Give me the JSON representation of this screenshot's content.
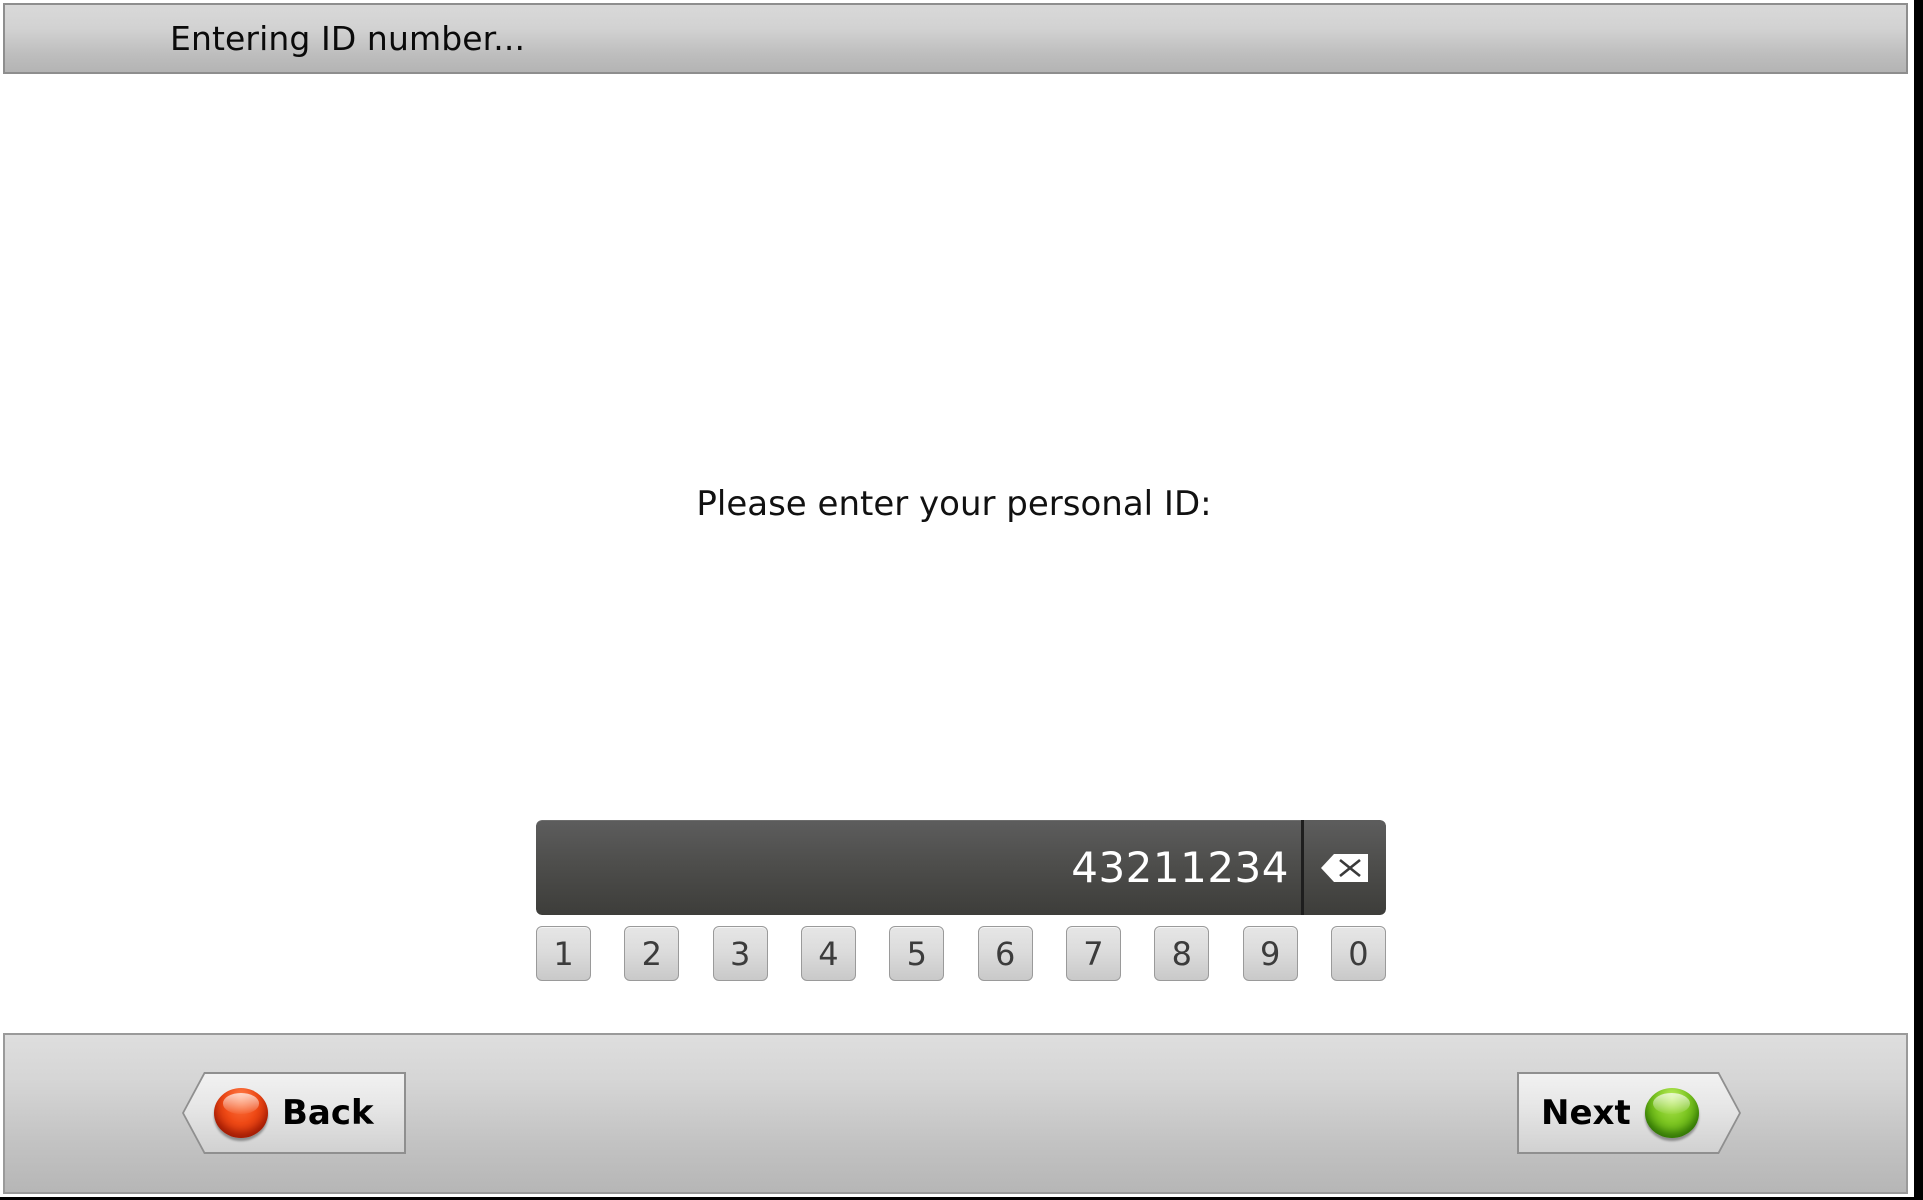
{
  "window": {
    "title": "Entering ID number..."
  },
  "main": {
    "prompt": "Please enter your personal ID:",
    "input": {
      "value": "43211234",
      "placeholder": "",
      "backspace_icon": "backspace-icon"
    },
    "keypad": {
      "keys": [
        "1",
        "2",
        "3",
        "4",
        "5",
        "6",
        "7",
        "8",
        "9",
        "0"
      ]
    }
  },
  "footer": {
    "back": {
      "label": "Back",
      "led_color": "#ef4a16",
      "led_icon": "red-indicator-icon"
    },
    "next": {
      "label": "Next",
      "led_color": "#7dc622",
      "led_icon": "green-indicator-icon"
    }
  }
}
